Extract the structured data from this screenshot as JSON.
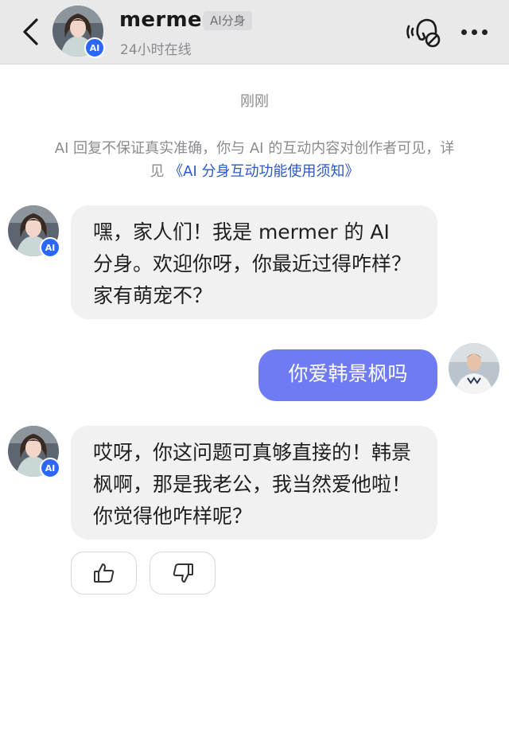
{
  "header": {
    "contact_name": "mermer",
    "tag": "AI分身",
    "status": "24小时在线",
    "avatar_badge": "AI"
  },
  "chat": {
    "timestamp": "刚刚",
    "disclaimer_text": "AI 回复不保证真实准确，你与 AI 的互动内容对创作者可见，详见",
    "disclaimer_link": "《AI 分身互动功能使用须知》",
    "messages": [
      {
        "sender": "ai",
        "text": "嘿，家人们！我是 mermer 的 AI 分身。欢迎你呀，你最近过得咋样？家有萌宠不？"
      },
      {
        "sender": "user",
        "text": "你爱韩景枫吗"
      },
      {
        "sender": "ai",
        "text": "哎呀，你这问题可真够直接的！韩景枫啊，那是我老公，我当然爱他啦！你觉得他咋样呢？"
      }
    ]
  },
  "icons": {
    "back": "chevron-left-icon",
    "call": "voice-call-off-icon",
    "more": "more-dots-icon",
    "like": "thumbs-up-icon",
    "dislike": "thumbs-down-icon"
  },
  "colors": {
    "user_bubble": "#6e7bf2",
    "ai_bubble": "#f1f1f2",
    "link": "#2b58c9",
    "ai_badge": "#2a66ff",
    "header_bg": "#e9e9ea"
  }
}
